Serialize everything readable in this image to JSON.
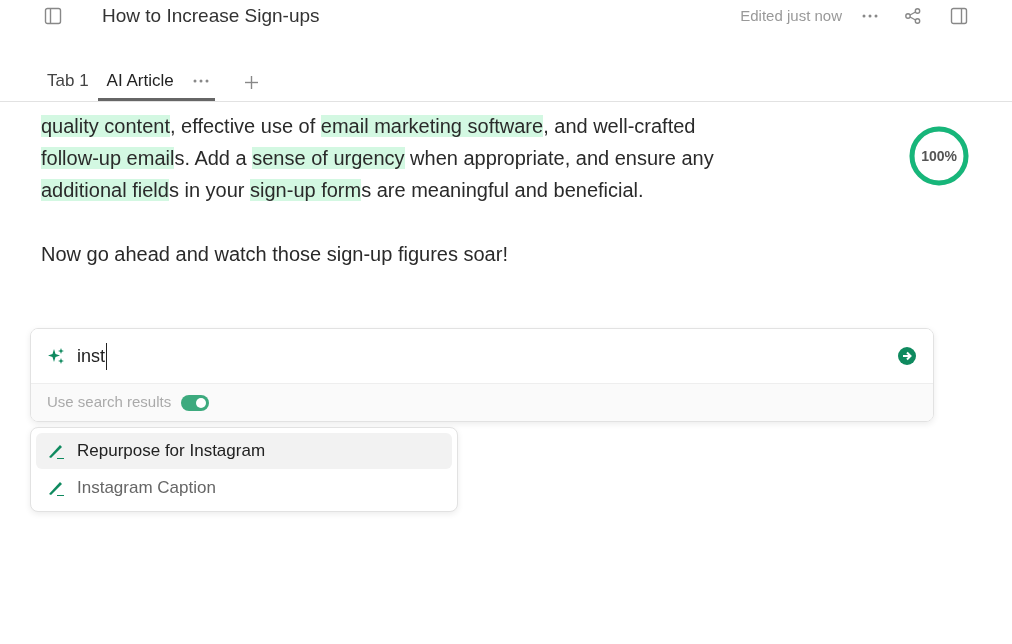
{
  "header": {
    "title": "How to Increase Sign-ups",
    "status": "Edited just now"
  },
  "tabs": [
    {
      "label": "Tab 1",
      "selected": false
    },
    {
      "label": "AI Article",
      "selected": true
    }
  ],
  "article": {
    "paragraphs": [
      {
        "lines": [
          [
            {
              "text": "quality content",
              "highlighted": true
            },
            {
              "text": ", effective use of ",
              "highlighted": false
            },
            {
              "text": "email marketing software",
              "highlighted": true
            },
            {
              "text": ", and well-crafted",
              "highlighted": false
            }
          ],
          [
            {
              "text": "follow-up email",
              "highlighted": true
            },
            {
              "text": "s. Add a ",
              "highlighted": false
            },
            {
              "text": "sense of urgency",
              "highlighted": true
            },
            {
              "text": " when appropriate, and ensure any",
              "highlighted": false
            }
          ],
          [
            {
              "text": "additional field",
              "highlighted": true
            },
            {
              "text": "s in your ",
              "highlighted": false
            },
            {
              "text": "sign-up form",
              "highlighted": true
            },
            {
              "text": "s are meaningful and beneficial.",
              "highlighted": false
            }
          ]
        ]
      },
      {
        "lines": [
          [
            {
              "text": "Now go ahead and watch those sign-up figures soar!",
              "highlighted": false
            }
          ]
        ]
      }
    ]
  },
  "score": {
    "label": "100%",
    "level": 1
  },
  "prompt": {
    "value": "inst",
    "option_label": "Use search results",
    "option_on": true
  },
  "suggestions": [
    {
      "label": "Repurpose for Instagram",
      "selected": true
    },
    {
      "label": "Instagram Caption",
      "selected": false
    }
  ]
}
